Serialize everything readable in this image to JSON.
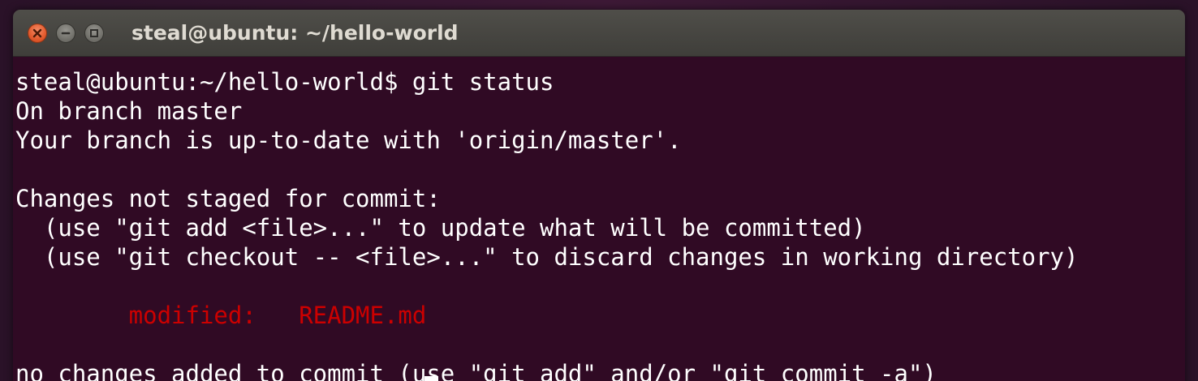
{
  "window": {
    "title": "steal@ubuntu: ~/hello-world",
    "controls": [
      "close-icon",
      "minimize-icon",
      "maximize-icon"
    ]
  },
  "terminal": {
    "colors": {
      "background": "#300a24",
      "foreground": "#ffffff",
      "modified": "#cc0000"
    },
    "lines": [
      "steal@ubuntu:~/hello-world$ git status",
      "On branch master",
      "Your branch is up-to-date with 'origin/master'.",
      "",
      "Changes not staged for commit:",
      "  (use \"git add <file>...\" to update what will be committed)",
      "  (use \"git checkout -- <file>...\" to discard changes in working directory)",
      "",
      "\tmodified:   README.md",
      "",
      "no changes added to commit (use \"git add\" and/or \"git commit -a\")"
    ],
    "modified_line": "        modified:   README.md"
  }
}
